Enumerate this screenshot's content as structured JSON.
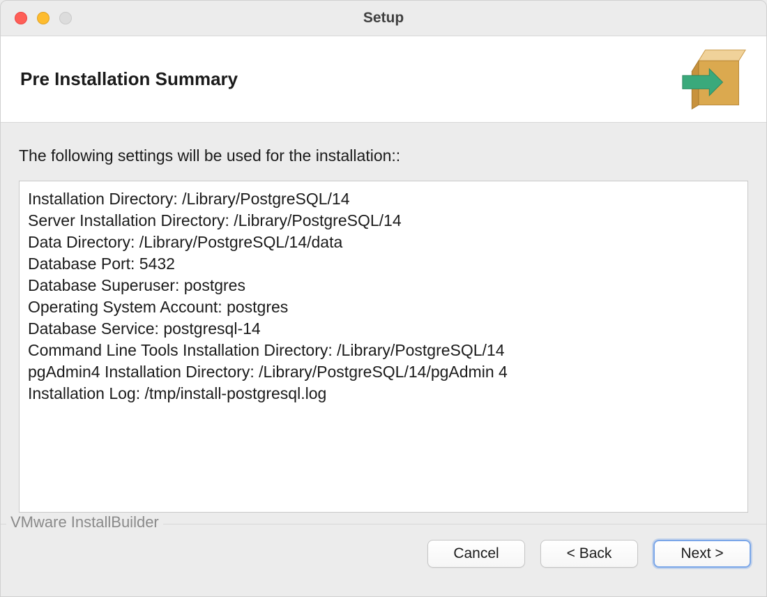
{
  "window": {
    "title": "Setup"
  },
  "header": {
    "title": "Pre Installation Summary"
  },
  "content": {
    "intro": "The following settings will be used for the installation::",
    "lines": [
      "Installation Directory: /Library/PostgreSQL/14",
      "Server Installation Directory: /Library/PostgreSQL/14",
      "Data Directory: /Library/PostgreSQL/14/data",
      "Database Port: 5432",
      "Database Superuser: postgres",
      "Operating System Account: postgres",
      "Database Service: postgresql-14",
      "Command Line Tools Installation Directory: /Library/PostgreSQL/14",
      "pgAdmin4 Installation Directory: /Library/PostgreSQL/14/pgAdmin 4",
      "Installation Log: /tmp/install-postgresql.log"
    ]
  },
  "footer": {
    "brand": "VMware InstallBuilder",
    "cancel": "Cancel",
    "back": "< Back",
    "next": "Next >"
  }
}
